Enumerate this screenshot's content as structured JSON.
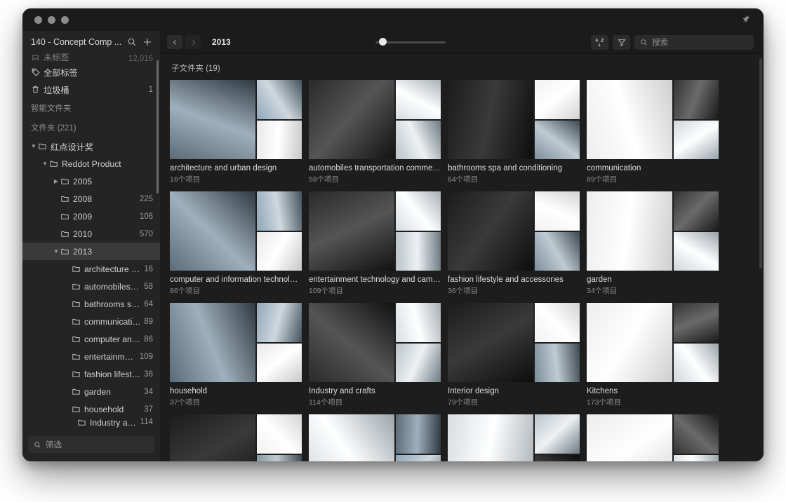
{
  "window": {
    "traffic_lights": [
      "close",
      "minimize",
      "maximize"
    ],
    "pin_icon": "pin-icon"
  },
  "sidebar": {
    "title": "140 - Concept Comp ...",
    "search_icon": "search-icon",
    "add_icon": "plus-icon",
    "clipped_top": {
      "label": "未标签",
      "count": "12,016"
    },
    "items": [
      {
        "label": "全部标签",
        "count": "",
        "icon": "tag-icon",
        "depth": 0,
        "twisty": "",
        "selected": false
      },
      {
        "label": "垃圾桶",
        "count": "1",
        "icon": "trash-icon",
        "depth": 0,
        "twisty": "",
        "selected": false
      }
    ],
    "sections": [
      {
        "label": "智能文件夹"
      },
      {
        "label": "文件夹 (221)"
      }
    ],
    "tree": [
      {
        "label": "红点设计奖",
        "count": "",
        "depth": 0,
        "twisty": "open",
        "selected": false
      },
      {
        "label": "Reddot Product",
        "count": "",
        "depth": 1,
        "twisty": "open",
        "selected": false
      },
      {
        "label": "2005",
        "count": "",
        "depth": 2,
        "twisty": "closed",
        "selected": false
      },
      {
        "label": "2008",
        "count": "225",
        "depth": 2,
        "twisty": "",
        "selected": false
      },
      {
        "label": "2009",
        "count": "106",
        "depth": 2,
        "twisty": "",
        "selected": false
      },
      {
        "label": "2010",
        "count": "570",
        "depth": 2,
        "twisty": "",
        "selected": false
      },
      {
        "label": "2013",
        "count": "",
        "depth": 2,
        "twisty": "open",
        "selected": true
      },
      {
        "label": "architecture and ...",
        "count": "16",
        "depth": 3,
        "twisty": "",
        "selected": false
      },
      {
        "label": "automobiles tran...",
        "count": "58",
        "depth": 3,
        "twisty": "",
        "selected": false
      },
      {
        "label": "bathrooms spa a...",
        "count": "64",
        "depth": 3,
        "twisty": "",
        "selected": false
      },
      {
        "label": "communication",
        "count": "89",
        "depth": 3,
        "twisty": "",
        "selected": false
      },
      {
        "label": "computer and in...",
        "count": "86",
        "depth": 3,
        "twisty": "",
        "selected": false
      },
      {
        "label": "entertainment te...",
        "count": "109",
        "depth": 3,
        "twisty": "",
        "selected": false
      },
      {
        "label": "fashion lifestyle ...",
        "count": "36",
        "depth": 3,
        "twisty": "",
        "selected": false
      },
      {
        "label": "garden",
        "count": "34",
        "depth": 3,
        "twisty": "",
        "selected": false
      },
      {
        "label": "household",
        "count": "37",
        "depth": 3,
        "twisty": "",
        "selected": false
      }
    ],
    "clipped_bottom": {
      "label": "Industry and craf...",
      "count": "114"
    },
    "filter": {
      "placeholder": "筛选",
      "icon": "search-icon"
    }
  },
  "toolbar": {
    "back_icon": "chevron-left-icon",
    "forward_icon": "chevron-right-icon",
    "breadcrumb": "2013",
    "zoom_slider": {
      "value": 5,
      "min": 0,
      "max": 100
    },
    "sort_icon": "sort-az-icon",
    "filter_icon": "funnel-icon",
    "search": {
      "placeholder": "搜索",
      "value": "",
      "icon": "search-icon"
    }
  },
  "content": {
    "section_label": "子文件夹 (19)",
    "cards": [
      {
        "title": "architecture and urban design",
        "count": "16个项目"
      },
      {
        "title": "automobiles transportation commer...",
        "count": "58个项目"
      },
      {
        "title": "bathrooms spa and conditioning",
        "count": "64个项目"
      },
      {
        "title": "communication",
        "count": "89个项目"
      },
      {
        "title": "computer and information technology",
        "count": "86个项目"
      },
      {
        "title": "entertainment technology and camera",
        "count": "109个项目"
      },
      {
        "title": "fashion lifestyle and accessories",
        "count": "36个项目"
      },
      {
        "title": "garden",
        "count": "34个项目"
      },
      {
        "title": "household",
        "count": "37个项目"
      },
      {
        "title": "Industry and crafts",
        "count": "114个项目"
      },
      {
        "title": "Interior design",
        "count": "79个项目"
      },
      {
        "title": "Kitchens",
        "count": "173个项目"
      }
    ]
  },
  "colors": {
    "window_bg": "#1d1d1d",
    "sidebar_bg": "#242424",
    "titlebar_bg": "#1b1b1b",
    "selection": "#3a3a3a",
    "text_primary": "#dcdcdc",
    "text_secondary": "#8e8e8e"
  }
}
